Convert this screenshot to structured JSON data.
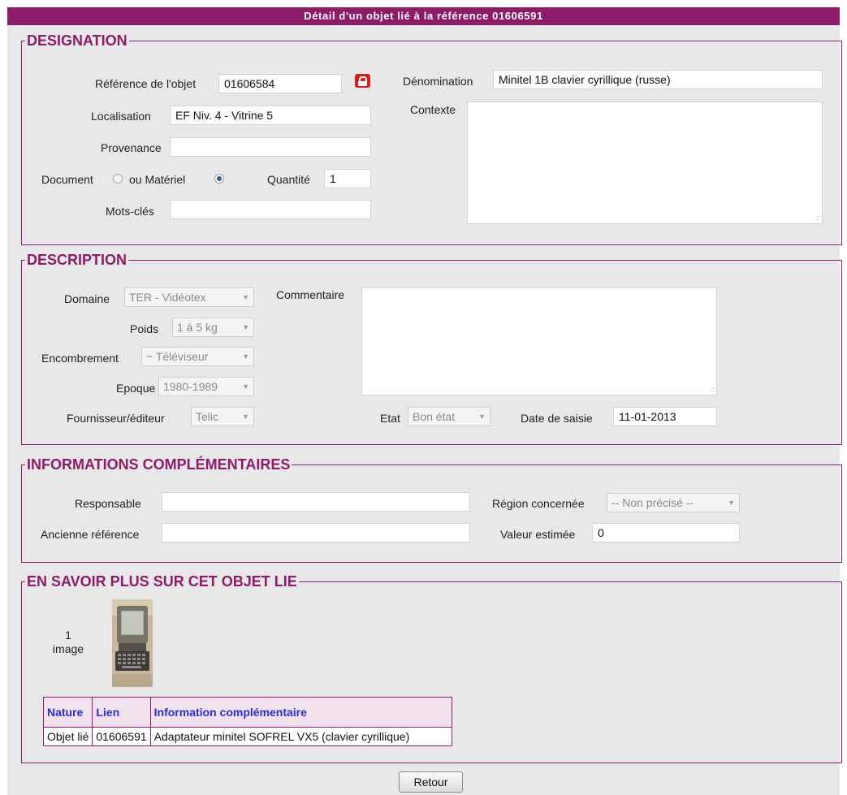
{
  "page_title": "Détail d'un objet lié à la référence 01606591",
  "designation": {
    "legend": "DESIGNATION",
    "reference_label": "Référence de l'objet",
    "reference_value": "01606584",
    "lock_icon": "lock-icon",
    "localisation_label": "Localisation",
    "localisation_value": "EF Niv. 4 - Vitrine 5",
    "provenance_label": "Provenance",
    "provenance_value": "",
    "document_label": "Document",
    "materiel_label": "ou Matériel",
    "selected_type": "Matériel",
    "quantite_label": "Quantité",
    "quantite_value": "1",
    "mots_cles_label": "Mots-clés",
    "mots_cles_value": "",
    "denomination_label": "Dénomination",
    "denomination_value": "Minitel 1B clavier cyrillique (russe)",
    "contexte_label": "Contexte",
    "contexte_value": ""
  },
  "description": {
    "legend": "DESCRIPTION",
    "domaine_label": "Domaine",
    "domaine_value": "TER - Vidéotex",
    "poids_label": "Poids",
    "poids_value": "1 à 5 kg",
    "encombrement_label": "Encombrement",
    "encombrement_value": "~ Téléviseur",
    "epoque_label": "Epoque",
    "epoque_value": "1980-1989",
    "fournisseur_label": "Fournisseur/éditeur",
    "fournisseur_value": "Telic",
    "commentaire_label": "Commentaire",
    "commentaire_value": "",
    "etat_label": "Etat",
    "etat_value": "Bon état",
    "date_saisie_label": "Date de saisie",
    "date_saisie_value": "11-01-2013"
  },
  "informations": {
    "legend": "INFORMATIONS COMPLÉMENTAIRES",
    "responsable_label": "Responsable",
    "responsable_value": "",
    "ancienne_ref_label": "Ancienne référence",
    "ancienne_ref_value": "",
    "region_label": "Région concernée",
    "region_value": "-- Non précisé --",
    "valeur_label": "Valeur estimée",
    "valeur_value": "0"
  },
  "en_savoir_plus": {
    "legend": "EN SAVOIR PLUS SUR CET OBJET LIE",
    "image_count": "1",
    "image_word": "image",
    "table_headers": [
      "Nature",
      "Lien",
      "Information complémentaire"
    ],
    "rows": [
      [
        "Objet lié",
        "01606591",
        "Adaptateur minitel SOFREL VX5 (clavier cyrillique)"
      ]
    ]
  },
  "retour_label": "Retour",
  "colors": {
    "accent": "#8e1b69",
    "header_link": "#2a2ad6",
    "background": "#e8e8e8"
  }
}
